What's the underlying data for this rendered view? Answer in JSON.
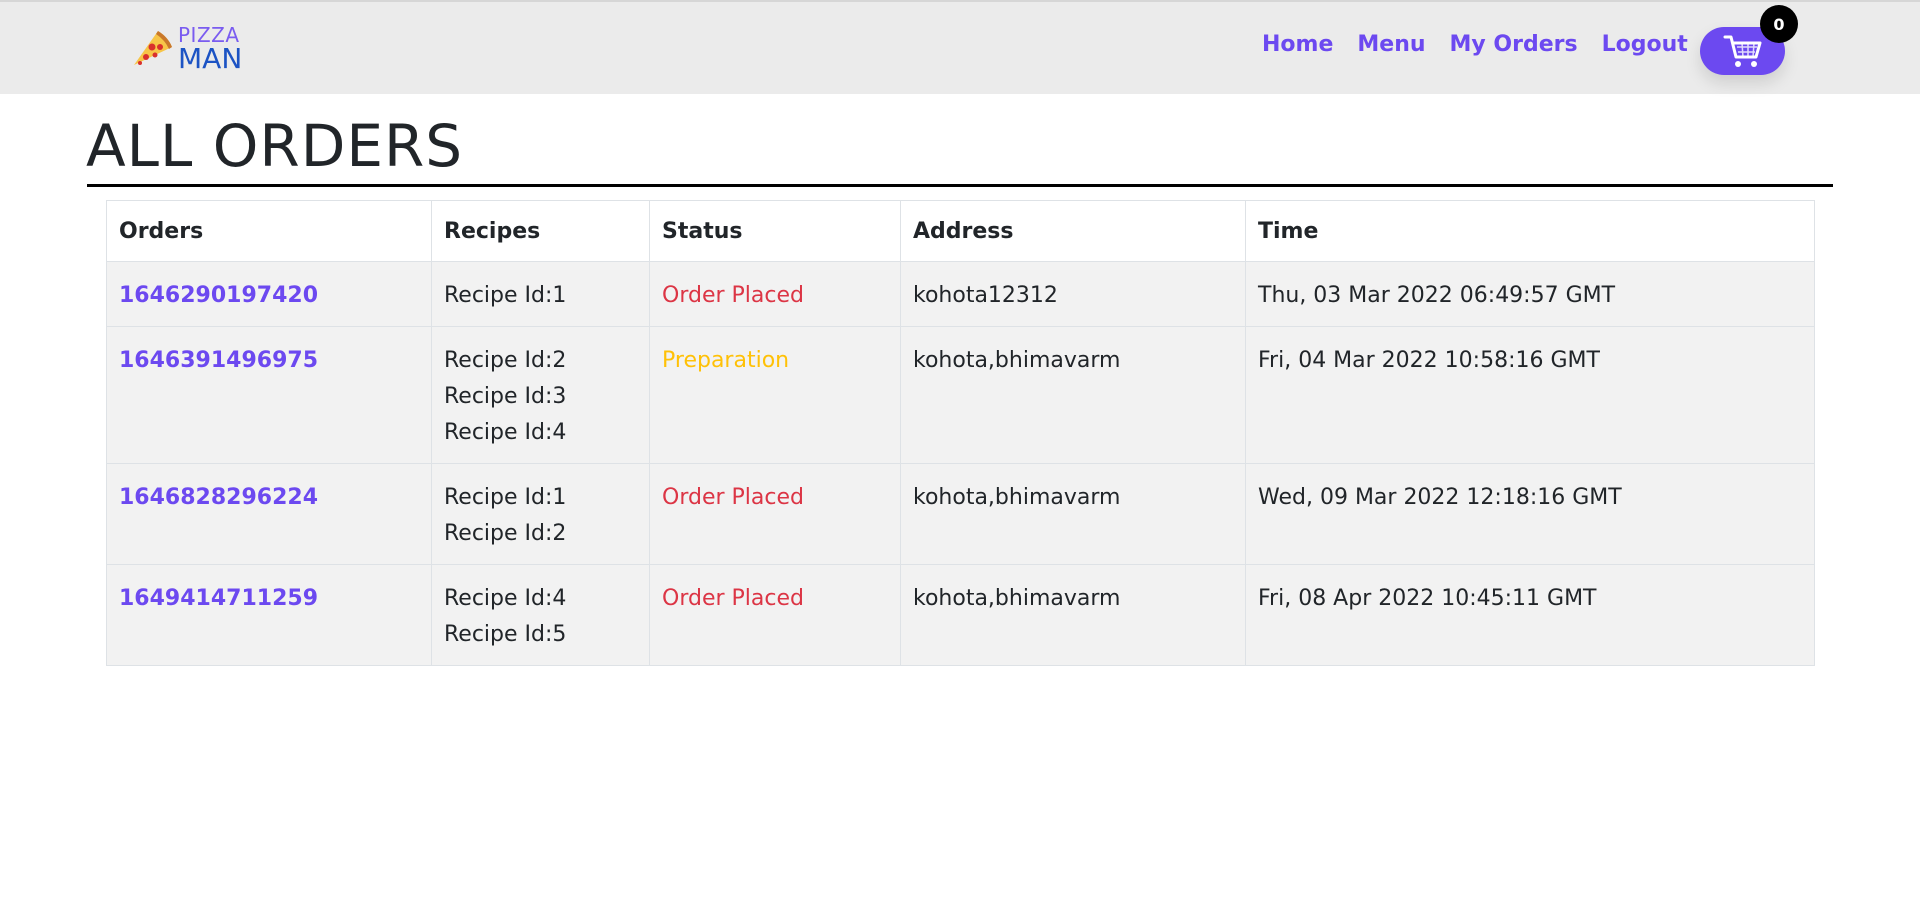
{
  "brand": {
    "name_top": "PIZZA",
    "name_bottom": "MAN",
    "logo_icon": "pizza-slice-icon"
  },
  "nav": {
    "home": "Home",
    "menu": "Menu",
    "my_orders": "My Orders",
    "logout": "Logout"
  },
  "cart": {
    "icon": "cart-icon",
    "count": "0"
  },
  "page": {
    "title": "ALL ORDERS"
  },
  "table": {
    "headers": {
      "orders": "Orders",
      "recipes": "Recipes",
      "status": "Status",
      "address": "Address",
      "time": "Time"
    },
    "rows": [
      {
        "order_id": "1646290197420",
        "recipes": [
          "Recipe Id:1"
        ],
        "status": "Order Placed",
        "address": "kohota12312",
        "time": "Thu, 03 Mar 2022 06:49:57 GMT"
      },
      {
        "order_id": "1646391496975",
        "recipes": [
          "Recipe Id:2",
          "Recipe Id:3",
          "Recipe Id:4"
        ],
        "status": "Preparation",
        "address": "kohota,bhimavarm",
        "time": "Fri, 04 Mar 2022 10:58:16 GMT"
      },
      {
        "order_id": "1646828296224",
        "recipes": [
          "Recipe Id:1",
          "Recipe Id:2"
        ],
        "status": "Order Placed",
        "address": "kohota,bhimavarm",
        "time": "Wed, 09 Mar 2022 12:18:16 GMT"
      },
      {
        "order_id": "1649414711259",
        "recipes": [
          "Recipe Id:4",
          "Recipe Id:5"
        ],
        "status": "Order Placed",
        "address": "kohota,bhimavarm",
        "time": "Fri, 08 Apr 2022 10:45:11 GMT"
      }
    ]
  },
  "colors": {
    "accent": "#6c49f0",
    "navbar_bg": "#ebebeb",
    "status_order_placed": "#dc3545",
    "status_preparation": "#ffc107",
    "row_bg": "#f2f2f2"
  }
}
